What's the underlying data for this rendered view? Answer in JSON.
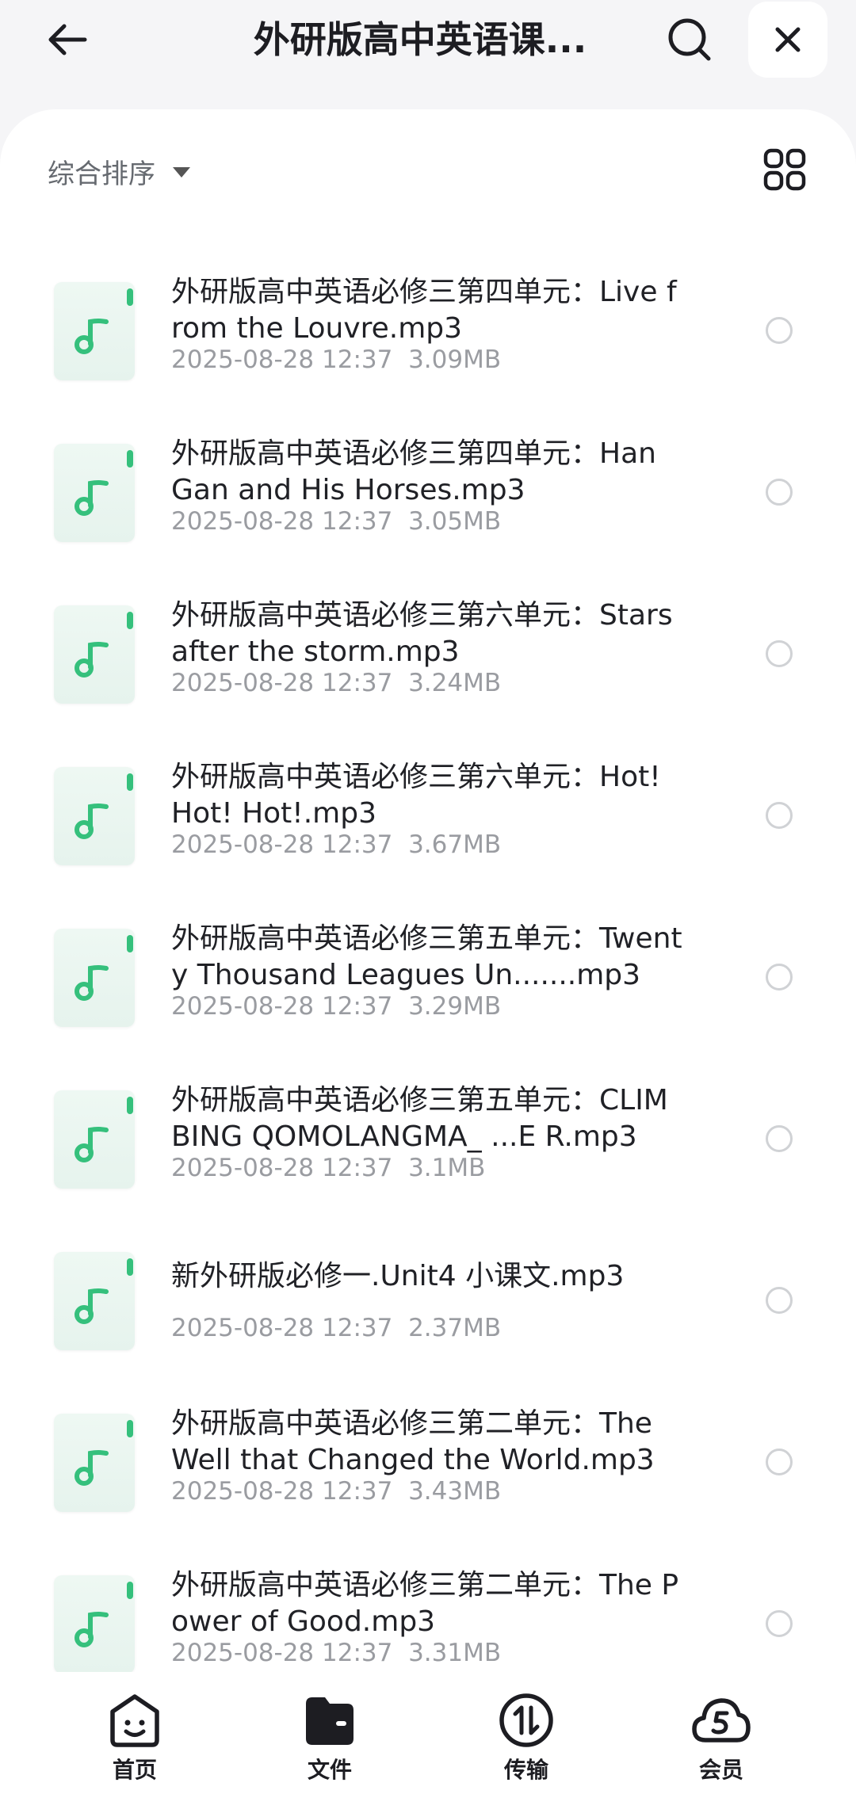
{
  "header": {
    "title": "外研版高中英语课...",
    "back_icon": "arrow-left-icon",
    "search_icon": "search-icon",
    "close_icon": "close-icon"
  },
  "toolbar": {
    "sort_label": "综合排序",
    "view_icon": "grid-view-icon"
  },
  "colors": {
    "accent": "#35c07c",
    "background": "#f5f5f7",
    "meta_text": "#9a9ca1"
  },
  "files": [
    {
      "name": "外研版高中英语必修三第四单元：Live from the Louvre.mp3",
      "date": "2025-08-28 12:37",
      "size": "3.09MB"
    },
    {
      "name": "外研版高中英语必修三第四单元：Han Gan and His Horses.mp3",
      "date": "2025-08-28 12:37",
      "size": "3.05MB"
    },
    {
      "name": "外研版高中英语必修三第六单元：Stars after the storm.mp3",
      "date": "2025-08-28 12:37",
      "size": "3.24MB"
    },
    {
      "name": "外研版高中英语必修三第六单元：Hot! Hot! Hot!.mp3",
      "date": "2025-08-28 12:37",
      "size": "3.67MB"
    },
    {
      "name": "外研版高中英语必修三第五单元：Twenty Thousand Leagues Un.......mp3",
      "date": "2025-08-28 12:37",
      "size": "3.29MB"
    },
    {
      "name": "外研版高中英语必修三第五单元：CLIMBING QOMOLANGMA_ ...E R.mp3",
      "date": "2025-08-28 12:37",
      "size": "3.1MB"
    },
    {
      "name": "新外研版必修一.Unit4 小课文.mp3",
      "date": "2025-08-28 12:37",
      "size": "2.37MB"
    },
    {
      "name": "外研版高中英语必修三第二单元：The Well that Changed the World.mp3",
      "date": "2025-08-28 12:37",
      "size": "3.43MB"
    },
    {
      "name": "外研版高中英语必修三第二单元：The Power of Good.mp3",
      "date": "2025-08-28 12:37",
      "size": "3.31MB"
    }
  ],
  "bottom_nav": [
    {
      "label": "首页",
      "icon": "home-face-icon"
    },
    {
      "label": "文件",
      "icon": "folder-icon"
    },
    {
      "label": "传输",
      "icon": "transfer-icon"
    },
    {
      "label": "会员",
      "icon": "vip-cloud-icon"
    }
  ]
}
